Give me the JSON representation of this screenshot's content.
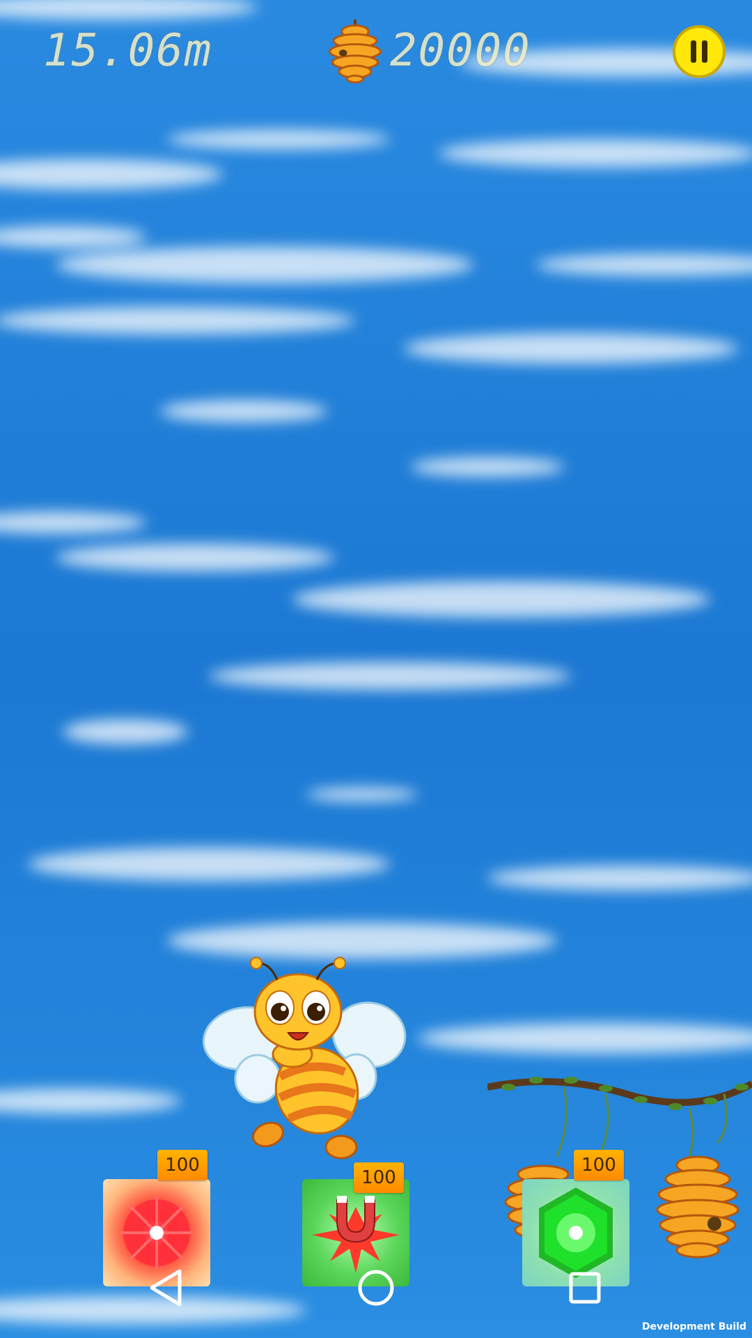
{
  "hud": {
    "distance": "15.06m",
    "score": "20000",
    "pause_icon": "pause-icon",
    "hive_icon": "beehive-icon"
  },
  "powerups": [
    {
      "name": "fire-burst",
      "count": "100",
      "icon": "red-burst-icon"
    },
    {
      "name": "magnet",
      "count": "100",
      "icon": "magnet-icon"
    },
    {
      "name": "shield",
      "count": "100",
      "icon": "green-hexagon-shield-icon"
    }
  ],
  "nav_bar": {
    "back_icon": "triangle-back-icon",
    "home_icon": "circle-home-icon",
    "recent_icon": "square-recents-icon"
  },
  "footer": {
    "build_label": "Development Build"
  },
  "colors": {
    "sky": "#1f7fd8",
    "cloud": "#ffffff",
    "hud_text": "#f3f0c8",
    "pause": "#ffe80a",
    "hive": "#f3a32a",
    "badge": "#ff9800"
  }
}
